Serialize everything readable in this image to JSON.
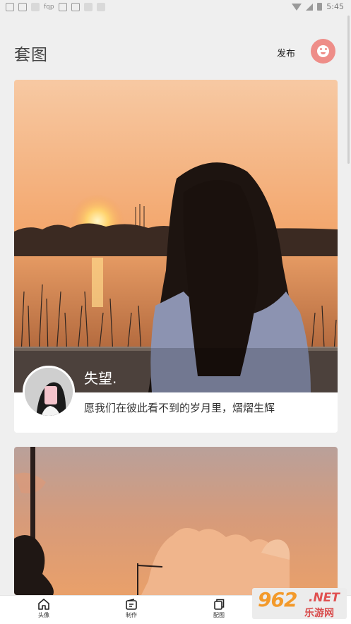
{
  "status_bar": {
    "carrier_text": "fqp",
    "time": "5:45"
  },
  "header": {
    "title": "套图",
    "publish_label": "发布"
  },
  "feed": [
    {
      "username": "失望.",
      "caption": "愿我们在彼此看不到的岁月里，熠熠生辉"
    }
  ],
  "bottom_nav": [
    {
      "label": "头像",
      "icon": "home-icon"
    },
    {
      "label": "制作",
      "icon": "edit-icon"
    },
    {
      "label": "配图",
      "icon": "copy-icon"
    }
  ],
  "watermark": {
    "number": "962",
    "suffix": ".NET",
    "text": "乐游网"
  },
  "colors": {
    "accent": "#ee8d88",
    "background": "#efefef"
  }
}
